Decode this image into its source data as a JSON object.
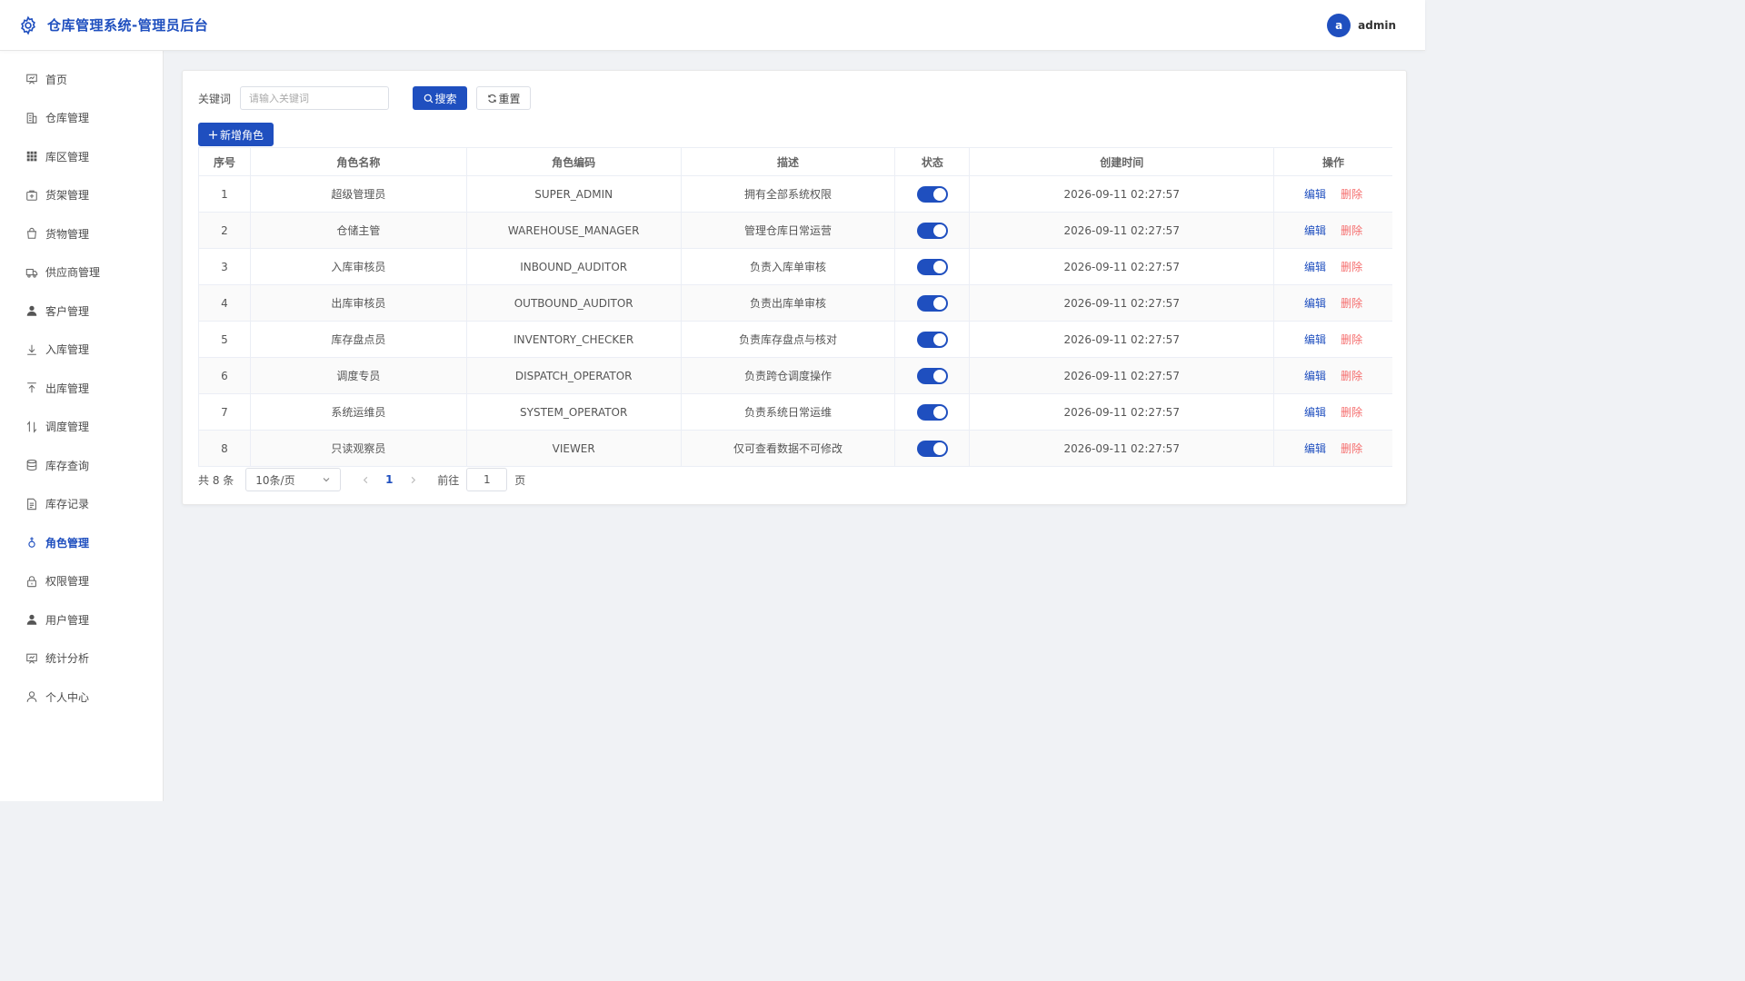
{
  "header": {
    "title": "仓库管理系统-管理员后台",
    "avatar_letter": "a",
    "username": "admin"
  },
  "sidebar": {
    "items": [
      {
        "label": "首页",
        "icon": "home-icon"
      },
      {
        "label": "仓库管理",
        "icon": "building-icon"
      },
      {
        "label": "库区管理",
        "icon": "grid-icon"
      },
      {
        "label": "货架管理",
        "icon": "shelf-icon"
      },
      {
        "label": "货物管理",
        "icon": "bag-icon"
      },
      {
        "label": "供应商管理",
        "icon": "truck-icon"
      },
      {
        "label": "客户管理",
        "icon": "user-icon"
      },
      {
        "label": "入库管理",
        "icon": "download-icon"
      },
      {
        "label": "出库管理",
        "icon": "upload-icon"
      },
      {
        "label": "调度管理",
        "icon": "sort-icon"
      },
      {
        "label": "库存查询",
        "icon": "database-icon"
      },
      {
        "label": "库存记录",
        "icon": "document-icon"
      },
      {
        "label": "角色管理",
        "icon": "role-icon",
        "active": true
      },
      {
        "label": "权限管理",
        "icon": "lock-icon"
      },
      {
        "label": "用户管理",
        "icon": "user-icon"
      },
      {
        "label": "统计分析",
        "icon": "chart-board-icon"
      },
      {
        "label": "个人中心",
        "icon": "person-outline-icon"
      }
    ]
  },
  "search": {
    "label": "关键词",
    "placeholder": "请输入关键词",
    "search_button": "搜索",
    "reset_button": "重置"
  },
  "toolbar": {
    "add_button": "新增角色"
  },
  "table": {
    "columns": [
      "序号",
      "角色名称",
      "角色编码",
      "描述",
      "状态",
      "创建时间",
      "操作"
    ],
    "rows": [
      {
        "index": "1",
        "name": "超级管理员",
        "code": "SUPER_ADMIN",
        "desc": "拥有全部系统权限",
        "enabled": true,
        "created": "2026-09-11 02:27:57"
      },
      {
        "index": "2",
        "name": "仓储主管",
        "code": "WAREHOUSE_MANAGER",
        "desc": "管理仓库日常运营",
        "enabled": true,
        "created": "2026-09-11 02:27:57"
      },
      {
        "index": "3",
        "name": "入库审核员",
        "code": "INBOUND_AUDITOR",
        "desc": "负责入库单审核",
        "enabled": true,
        "created": "2026-09-11 02:27:57"
      },
      {
        "index": "4",
        "name": "出库审核员",
        "code": "OUTBOUND_AUDITOR",
        "desc": "负责出库单审核",
        "enabled": true,
        "created": "2026-09-11 02:27:57"
      },
      {
        "index": "5",
        "name": "库存盘点员",
        "code": "INVENTORY_CHECKER",
        "desc": "负责库存盘点与核对",
        "enabled": true,
        "created": "2026-09-11 02:27:57"
      },
      {
        "index": "6",
        "name": "调度专员",
        "code": "DISPATCH_OPERATOR",
        "desc": "负责跨仓调度操作",
        "enabled": true,
        "created": "2026-09-11 02:27:57"
      },
      {
        "index": "7",
        "name": "系统运维员",
        "code": "SYSTEM_OPERATOR",
        "desc": "负责系统日常运维",
        "enabled": true,
        "created": "2026-09-11 02:27:57"
      },
      {
        "index": "8",
        "name": "只读观察员",
        "code": "VIEWER",
        "desc": "仅可查看数据不可修改",
        "enabled": true,
        "created": "2026-09-11 02:27:57"
      }
    ],
    "edit_label": "编辑",
    "delete_label": "删除"
  },
  "pagination": {
    "total_text": "共 8 条",
    "page_size": "10条/页",
    "current_page": "1",
    "goto_label": "前往",
    "goto_value": "1",
    "page_unit": "页"
  },
  "colors": {
    "primary": "#1f4fbf",
    "danger": "#f56c6c"
  }
}
